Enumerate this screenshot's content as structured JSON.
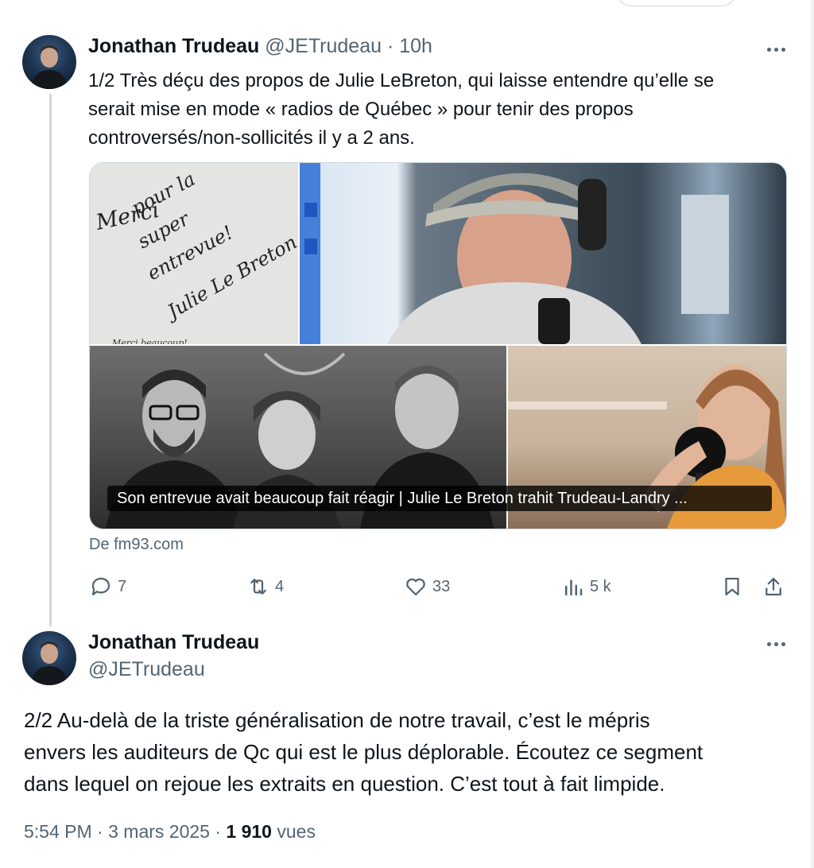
{
  "tweet1": {
    "author_name": "Jonathan Trudeau",
    "handle": "@JETrudeau",
    "separator": "·",
    "time": "10h",
    "text_lines": [
      "1/2 Très déçu des propos de Julie LeBreton, qui laisse entendre qu’elle se",
      "serait mise en mode « radios de Québec » pour tenir des propos",
      "controversés/non-sollicités il y a 2 ans."
    ],
    "link_card": {
      "caption": "Son entrevue avait beaucoup fait réagir | Julie Le Breton trahit Trudeau-Landry ...",
      "source": "De fm93.com",
      "handwriting_lines": [
        "Merci",
        "pour la",
        "super",
        "entrevue!",
        "Julie Le Breton"
      ],
      "handwriting_footer": "Merci beaucoup!"
    },
    "actions": {
      "replies": "7",
      "reposts": "4",
      "likes": "33",
      "views": "5 k"
    }
  },
  "tweet2": {
    "author_name": "Jonathan Trudeau",
    "handle": "@JETrudeau",
    "text_lines": [
      "2/2  Au-delà de la triste généralisation de notre travail, c’est le mépris",
      "envers les auditeurs de Qc qui est le plus déplorable. Écoutez ce segment",
      "dans lequel on rejoue les extraits en question. C’est tout à fait limpide."
    ],
    "time": "5:54 PM",
    "date": "3 mars 2025",
    "views_count": "1 910",
    "views_label": "vues",
    "separator": "·"
  },
  "colors": {
    "text": "#0f1419",
    "muted": "#536471",
    "border": "#cfd9de"
  },
  "icons": [
    "more-icon",
    "reply-icon",
    "repost-icon",
    "like-icon",
    "views-icon",
    "bookmark-icon",
    "share-icon"
  ]
}
